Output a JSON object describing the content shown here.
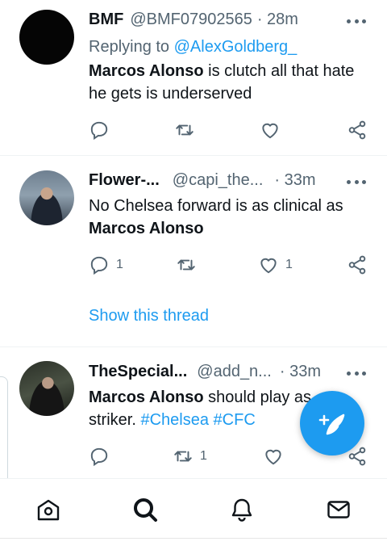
{
  "tweets": [
    {
      "name": "BMF",
      "handle": "@BMF07902565",
      "time": "· 28m",
      "replying_label": "Replying to",
      "replying_handle": "@AlexGoldberg_",
      "text_bold": "Marcos Alonso",
      "text_rest": " is clutch all that hate he gets is underserved",
      "reply_count": "",
      "retweet_count": "",
      "like_count": ""
    },
    {
      "name": "Flower-...",
      "handle": "@capi_the...",
      "time": "· 33m",
      "text_plain": "No Chelsea forward is as clinical as",
      "text_bold": "Marcos Alonso",
      "reply_count": "1",
      "retweet_count": "",
      "like_count": "1",
      "show_thread": "Show this thread"
    },
    {
      "name": "TheSpecial...",
      "handle": "@add_n...",
      "time": "· 33m",
      "text_bold": "Marcos Alonso",
      "text_rest": " should play as striker.",
      "hashtag1": "#Chelsea",
      "hashtag2": "#CFC",
      "reply_count": "",
      "retweet_count": "1",
      "like_count": ""
    }
  ],
  "nav": {
    "items": [
      "home-icon",
      "search-icon",
      "notifications-icon",
      "messages-icon"
    ]
  },
  "colors": {
    "accent": "#1d9bf0",
    "text": "#0f1419",
    "secondary": "#536471"
  }
}
